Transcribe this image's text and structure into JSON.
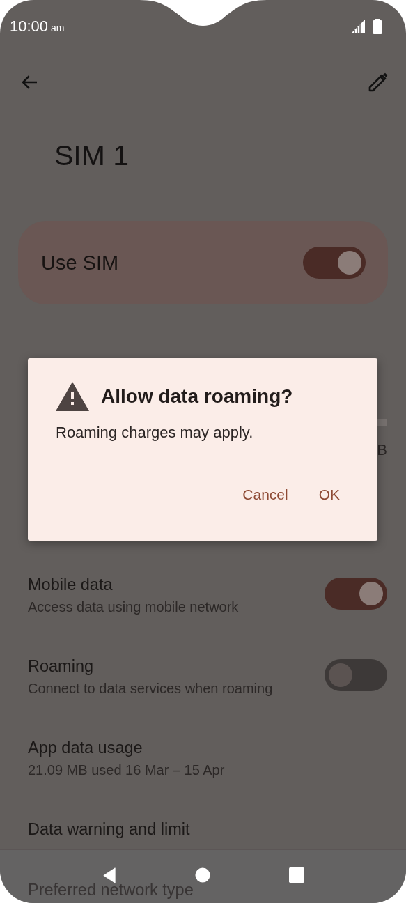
{
  "status_bar": {
    "time": "10:00",
    "time_suffix": "am"
  },
  "toolbar": {
    "title": "SIM 1"
  },
  "use_sim": {
    "label": "Use SIM",
    "on": true
  },
  "usage": {
    "reading": "B"
  },
  "settings": [
    {
      "kind": "toggle",
      "title": "Mobile data",
      "subtitle": "Access data using mobile network",
      "on": true
    },
    {
      "kind": "toggle",
      "title": "Roaming",
      "subtitle": "Connect to data services when roaming",
      "on": false
    },
    {
      "kind": "plain",
      "title": "App data usage",
      "subtitle": "21.09 MB used 16 Mar – 15 Apr"
    },
    {
      "kind": "plain",
      "title": "Data warning and limit"
    },
    {
      "kind": "plain",
      "title": "Preferred network type"
    }
  ],
  "dialog": {
    "title": "Allow data roaming?",
    "message": "Roaming charges may apply.",
    "buttons": [
      "Cancel",
      "OK"
    ]
  }
}
